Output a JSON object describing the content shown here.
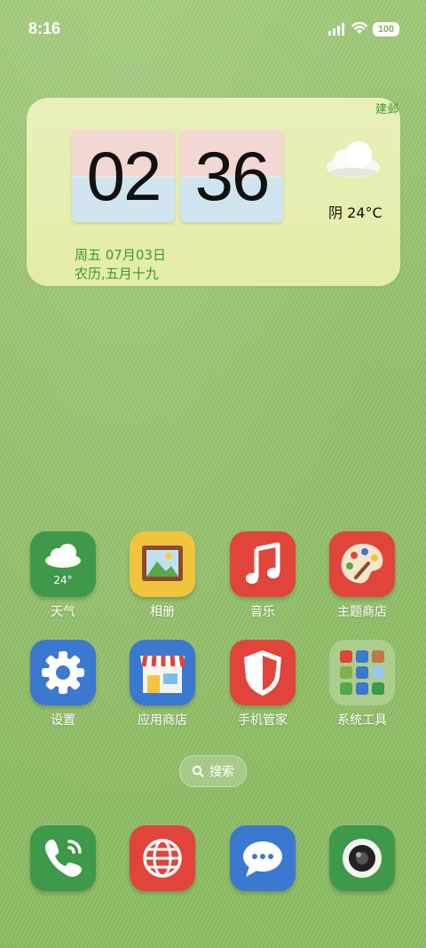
{
  "status_bar": {
    "time": "8:16",
    "battery": "100",
    "icons": [
      "signal-icon",
      "wifi-icon",
      "battery-icon"
    ]
  },
  "widget": {
    "city": "建邺",
    "hour": "02",
    "minute": "36",
    "weather": "阴 24°C",
    "date_line": "周五 07月03日",
    "lunar_line": "农历,五月十九",
    "icons": [
      "cloud-icon"
    ]
  },
  "apps": [
    {
      "label": "天气",
      "icon": "weather-icon",
      "badge": "24°"
    },
    {
      "label": "相册",
      "icon": "gallery-icon"
    },
    {
      "label": "音乐",
      "icon": "music-icon"
    },
    {
      "label": "主题商店",
      "icon": "palette-icon"
    },
    {
      "label": "设置",
      "icon": "gear-icon"
    },
    {
      "label": "应用商店",
      "icon": "store-icon"
    },
    {
      "label": "手机管家",
      "icon": "shield-icon"
    },
    {
      "label": "系统工具",
      "icon": "folder-icon"
    }
  ],
  "search": {
    "label": "搜索",
    "icon": "search-icon"
  },
  "dock": [
    {
      "icon": "phone-icon"
    },
    {
      "icon": "browser-icon"
    },
    {
      "icon": "messages-icon"
    },
    {
      "icon": "camera-icon"
    }
  ],
  "colors": {
    "accent_green": "#3a9a2a",
    "background": "#94c16b"
  }
}
